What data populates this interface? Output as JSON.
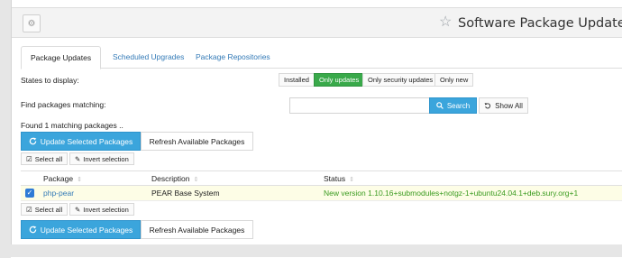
{
  "header": {
    "title": "Software Package Updates",
    "gear_icon": "⚙",
    "star_icon": "☆"
  },
  "tabs": [
    {
      "label": "Package Updates",
      "active": true
    },
    {
      "label": "Scheduled Upgrades",
      "active": false
    },
    {
      "label": "Package Repositories",
      "active": false
    }
  ],
  "filters": {
    "states_label": "States to display:",
    "options": [
      "Installed",
      "Only updates",
      "Only security updates",
      "Only new"
    ],
    "selected": "Only updates"
  },
  "search": {
    "label": "Find packages matching:",
    "value": "",
    "search_button": "Search",
    "show_all_button": "Show All"
  },
  "result_text": "Found 1 matching packages ..",
  "actions": {
    "update_selected": "Update Selected Packages",
    "refresh": "Refresh Available Packages",
    "select_all": "Select all",
    "invert_selection": "Invert selection"
  },
  "table": {
    "columns": [
      "Package",
      "Description",
      "Status"
    ],
    "rows": [
      {
        "checked": true,
        "package": "php-pear",
        "description": "PEAR Base System",
        "status": "New version 1.10.16+submodules+notgz-1+ubuntu24.04.1+deb.sury.org+1"
      }
    ]
  },
  "colors": {
    "accent_blue": "#3ba5dc",
    "selected_green": "#39a94a",
    "status_green": "#3a9b1f",
    "link_blue": "#337ab7"
  }
}
